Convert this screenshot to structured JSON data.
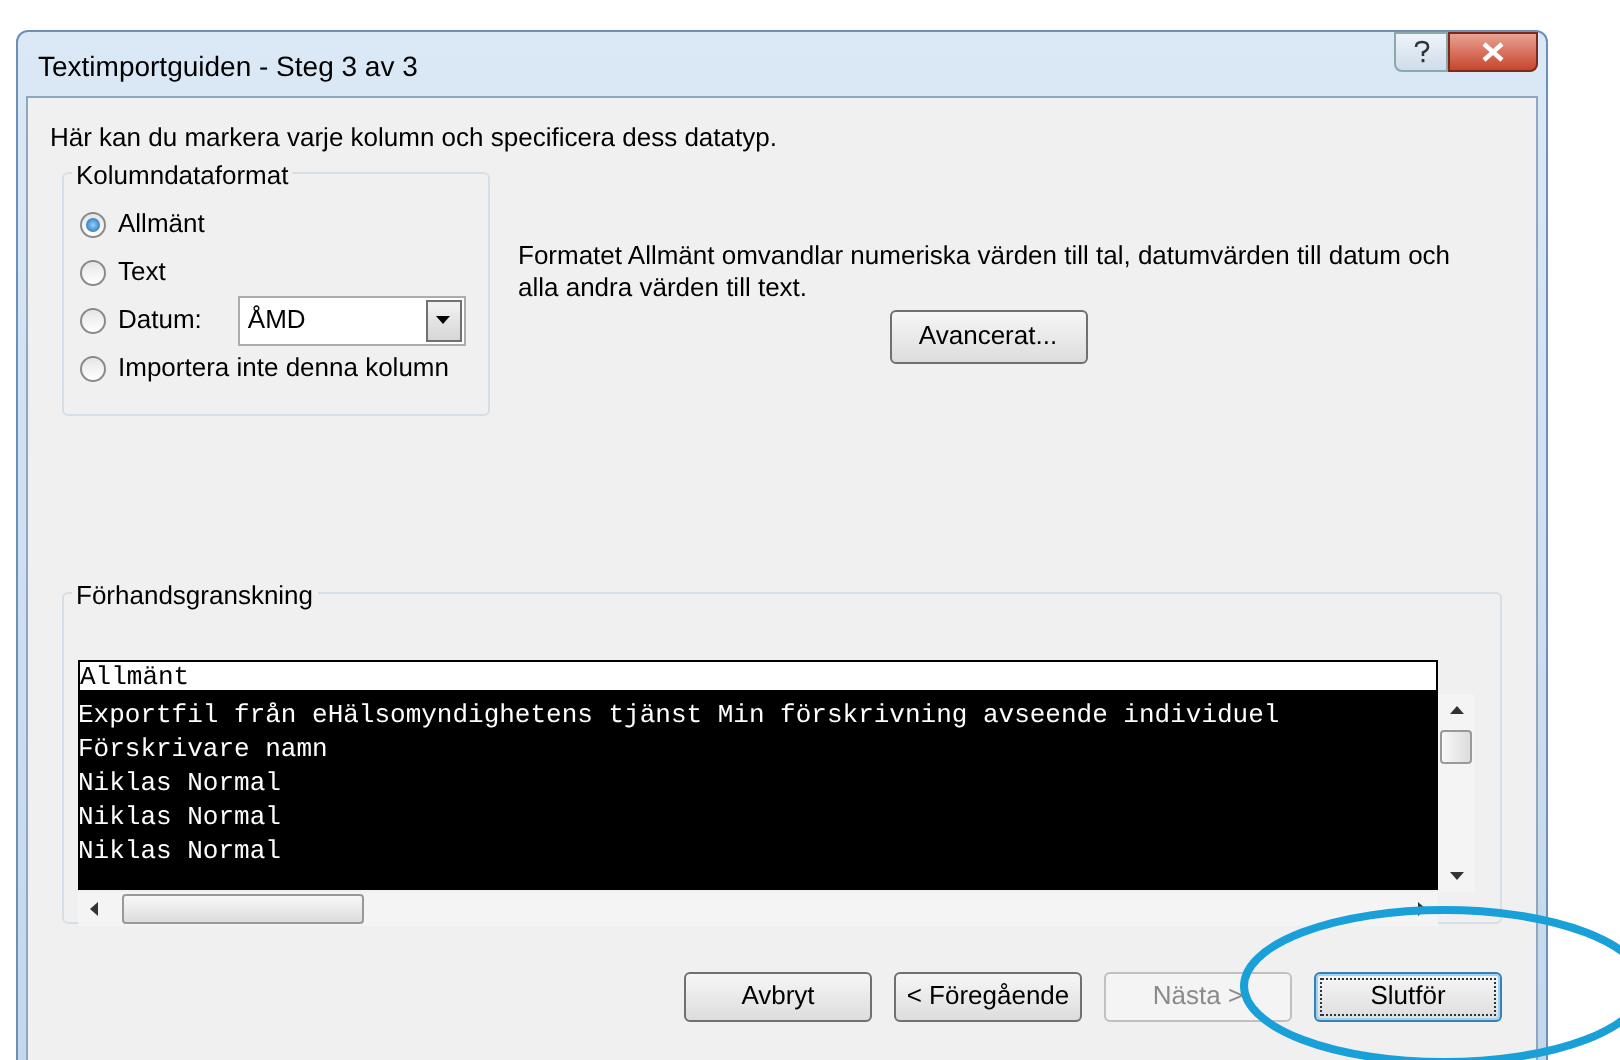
{
  "window": {
    "title": "Textimportguiden - Steg 3 av 3"
  },
  "intro": "Här kan du markera varje kolumn och specificera dess datatyp.",
  "column_format": {
    "legend": "Kolumndataformat",
    "date_value": "ÅMD",
    "options": [
      {
        "label": "Allmänt",
        "selected": true,
        "kind": "plain"
      },
      {
        "label": "Text",
        "selected": false,
        "kind": "plain"
      },
      {
        "label": "Datum:",
        "selected": false,
        "kind": "date"
      },
      {
        "label": "Importera inte denna kolumn",
        "selected": false,
        "kind": "plain"
      }
    ]
  },
  "description": "Formatet Allmänt omvandlar numeriska värden till tal, datumvärden till datum och alla andra värden till text.",
  "advanced_button": "Avancerat...",
  "preview": {
    "legend": "Förhandsgranskning",
    "header": "Allmänt",
    "rows": [
      "Exportfil från eHälsomyndighetens tjänst Min förskrivning avseende individuel",
      "Förskrivare namn",
      "Niklas Normal",
      "Niklas Normal",
      "Niklas Normal"
    ]
  },
  "buttons": [
    {
      "label": "Avbryt",
      "disabled": false,
      "default": false
    },
    {
      "label": "< Föregående",
      "disabled": false,
      "default": false
    },
    {
      "label": "Nästa >",
      "disabled": true,
      "default": false
    },
    {
      "label": "Slutför",
      "disabled": false,
      "default": true
    }
  ]
}
